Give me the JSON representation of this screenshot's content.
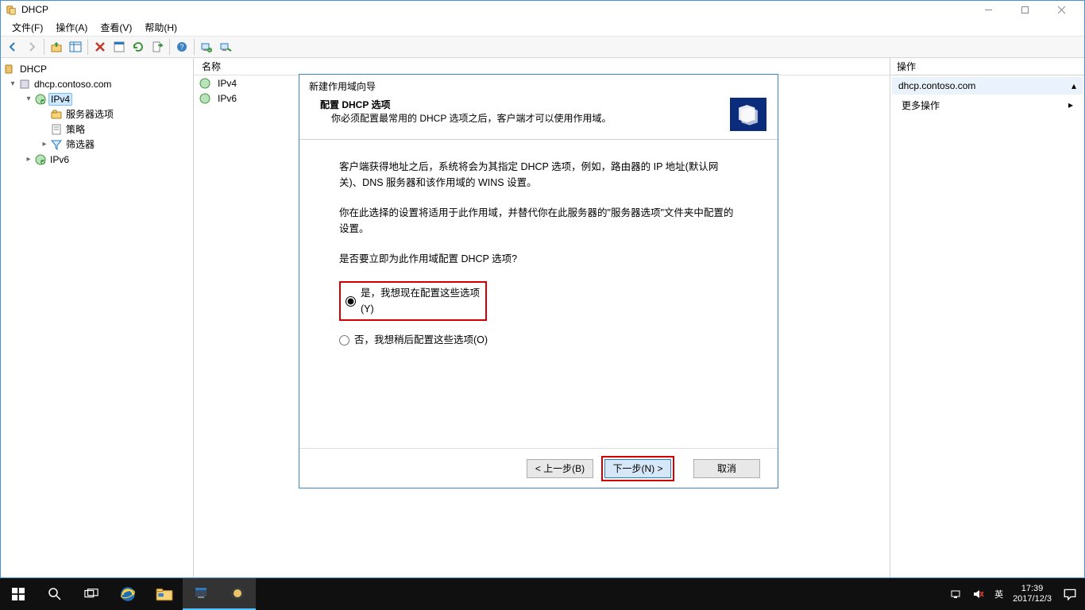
{
  "window": {
    "title": "DHCP"
  },
  "menubar": {
    "file": "文件(F)",
    "action": "操作(A)",
    "view": "查看(V)",
    "help": "帮助(H)"
  },
  "tree": {
    "root": "DHCP",
    "server": "dhcp.contoso.com",
    "ipv4": "IPv4",
    "server_options": "服务器选项",
    "policies": "策略",
    "filters": "筛选器",
    "ipv6": "IPv6"
  },
  "list": {
    "header_name": "名称",
    "items": [
      "IPv4",
      "IPv6"
    ]
  },
  "actions": {
    "header": "操作",
    "selected": "dhcp.contoso.com",
    "more": "更多操作"
  },
  "wizard": {
    "title": "新建作用域向导",
    "head_bold": "配置 DHCP 选项",
    "head_sub": "你必须配置最常用的 DHCP 选项之后，客户端才可以使用作用域。",
    "p1": "客户端获得地址之后，系统将会为其指定 DHCP 选项，例如，路由器的 IP 地址(默认网关)、DNS 服务器和该作用域的 WINS 设置。",
    "p2": "你在此选择的设置将适用于此作用域，并替代你在此服务器的\"服务器选项\"文件夹中配置的设置。",
    "q": "是否要立即为此作用域配置 DHCP 选项?",
    "opt_yes": "是，我想现在配置这些选项(Y)",
    "opt_no": "否，我想稍后配置这些选项(O)",
    "back": "< 上一步(B)",
    "next": "下一步(N) >",
    "cancel": "取消"
  },
  "taskbar": {
    "ime": "英",
    "time": "17:39",
    "date": "2017/12/3"
  }
}
